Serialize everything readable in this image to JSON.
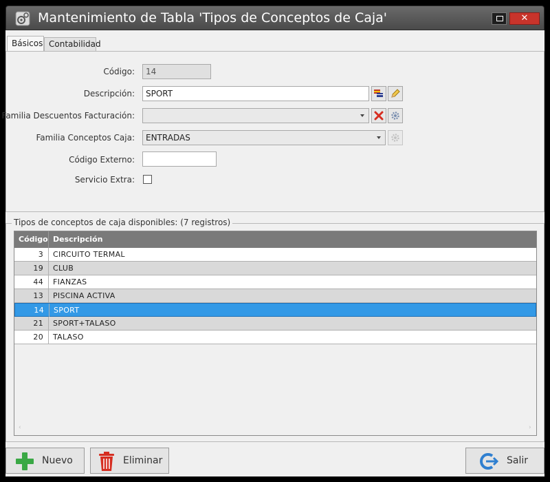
{
  "window": {
    "title": "Mantenimiento de Tabla 'Tipos de Conceptos de Caja'",
    "close_label": "✕"
  },
  "tabs": [
    {
      "label": "Básicos",
      "active": true
    },
    {
      "label": "Contabilidad",
      "active": false
    }
  ],
  "form": {
    "codigo_label": "Código:",
    "codigo_value": "14",
    "descripcion_label": "Descripción:",
    "descripcion_value": "SPORT",
    "familia_desc_label": "Familia Descuentos Facturación:",
    "familia_desc_value": "",
    "familia_conceptos_label": "Familia Conceptos Caja:",
    "familia_conceptos_value": "ENTRADAS",
    "codigo_externo_label": "Código Externo:",
    "codigo_externo_value": "",
    "servicio_extra_label": "Servicio Extra:",
    "servicio_extra_checked": false
  },
  "grid": {
    "caption": "Tipos de conceptos de caja disponibles:  (7 registros)",
    "columns": [
      "Código",
      "Descripción"
    ],
    "rows": [
      {
        "code": "3",
        "desc": "CIRCUITO TERMAL"
      },
      {
        "code": "19",
        "desc": "CLUB"
      },
      {
        "code": "44",
        "desc": "FIANZAS"
      },
      {
        "code": "13",
        "desc": "PISCINA ACTIVA"
      },
      {
        "code": "14",
        "desc": "SPORT"
      },
      {
        "code": "21",
        "desc": "SPORT+TALASO"
      },
      {
        "code": "20",
        "desc": "TALASO"
      }
    ],
    "selected_index": 4,
    "scroll_left": "‹",
    "scroll_right": "›"
  },
  "actions": {
    "nuevo": "Nuevo",
    "eliminar": "Eliminar",
    "salir": "Salir"
  },
  "colors": {
    "selection": "#3399e6",
    "header": "#7a7a7a",
    "close": "#c8342b"
  }
}
